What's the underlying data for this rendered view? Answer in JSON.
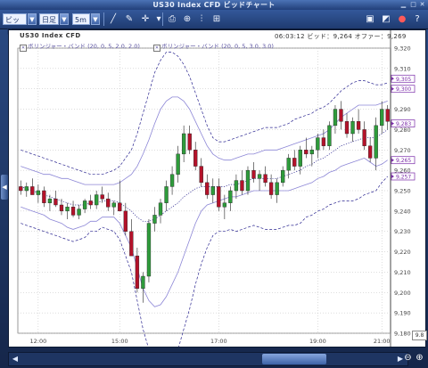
{
  "window": {
    "title": "US30 Index CFD ビッドチャート"
  },
  "toolbar": {
    "price_type": "ビッド",
    "chart_style": "日足",
    "timeframe": "5m"
  },
  "chart_header": {
    "symbol": "US30 Index CFD",
    "quote": "06:03:12 ビッド：9,264 オファー：9,269",
    "indicators": [
      "ボリンジャー・バンド (20, 0, 5, 2.0, 2.0)",
      "ボリンジャー・バンド (20, 0, 5, 3.0, 3.0)"
    ]
  },
  "markers": {
    "m1": "9,305",
    "m2": "9,300",
    "m3": "9,283",
    "m4": "9,265",
    "m5": "9,257"
  },
  "scale_tag": "9.8",
  "colors": {
    "up": "#2e9b3b",
    "down": "#b4122a",
    "band_inner": "#8c86d6",
    "band_outer": "#2a2590",
    "ma": "#2a2590",
    "marker": "#7a2aa8"
  },
  "chart_data": {
    "type": "candlestick",
    "x_ticks": [
      "12:00",
      "15:00",
      "17:00",
      "19:00",
      "21:00"
    ],
    "y_ticks": [
      "9,320",
      "9,310",
      "9,300",
      "9,290",
      "9,280",
      "9,270",
      "9,260",
      "9,250",
      "9,240",
      "9,230",
      "9,220",
      "9,210",
      "9,200",
      "9,190",
      "9,180"
    ],
    "ylim": [
      9180,
      9320
    ],
    "candles": [
      [
        9252,
        9255,
        9248,
        9250
      ],
      [
        9250,
        9254,
        9247,
        9252
      ],
      [
        9252,
        9256,
        9249,
        9248
      ],
      [
        9248,
        9253,
        9244,
        9250
      ],
      [
        9250,
        9252,
        9242,
        9244
      ],
      [
        9244,
        9248,
        9240,
        9246
      ],
      [
        9246,
        9250,
        9242,
        9243
      ],
      [
        9243,
        9246,
        9238,
        9240
      ],
      [
        9240,
        9244,
        9236,
        9242
      ],
      [
        9242,
        9245,
        9237,
        9238
      ],
      [
        9238,
        9243,
        9236,
        9241
      ],
      [
        9241,
        9246,
        9239,
        9245
      ],
      [
        9245,
        9248,
        9241,
        9243
      ],
      [
        9243,
        9250,
        9241,
        9248
      ],
      [
        9248,
        9252,
        9244,
        9246
      ],
      [
        9246,
        9249,
        9240,
        9242
      ],
      [
        9242,
        9245,
        9238,
        9244
      ],
      [
        9244,
        9255,
        9242,
        9240
      ],
      [
        9240,
        9244,
        9228,
        9230
      ],
      [
        9230,
        9236,
        9220,
        9218
      ],
      [
        9218,
        9222,
        9200,
        9202
      ],
      [
        9202,
        9210,
        9195,
        9208
      ],
      [
        9208,
        9236,
        9205,
        9234
      ],
      [
        9234,
        9242,
        9230,
        9238
      ],
      [
        9238,
        9246,
        9234,
        9244
      ],
      [
        9244,
        9255,
        9240,
        9252
      ],
      [
        9252,
        9262,
        9248,
        9258
      ],
      [
        9258,
        9272,
        9254,
        9268
      ],
      [
        9268,
        9282,
        9264,
        9278
      ],
      [
        9278,
        9282,
        9268,
        9270
      ],
      [
        9270,
        9274,
        9260,
        9262
      ],
      [
        9262,
        9266,
        9252,
        9254
      ],
      [
        9254,
        9258,
        9246,
        9248
      ],
      [
        9248,
        9256,
        9244,
        9252
      ],
      [
        9252,
        9256,
        9240,
        9242
      ],
      [
        9242,
        9248,
        9236,
        9244
      ],
      [
        9244,
        9252,
        9240,
        9250
      ],
      [
        9250,
        9258,
        9246,
        9255
      ],
      [
        9255,
        9260,
        9248,
        9250
      ],
      [
        9250,
        9262,
        9248,
        9260
      ],
      [
        9260,
        9264,
        9254,
        9256
      ],
      [
        9256,
        9260,
        9250,
        9258
      ],
      [
        9258,
        9262,
        9252,
        9254
      ],
      [
        9254,
        9258,
        9246,
        9248
      ],
      [
        9248,
        9256,
        9244,
        9254
      ],
      [
        9254,
        9262,
        9252,
        9260
      ],
      [
        9260,
        9268,
        9256,
        9266
      ],
      [
        9266,
        9270,
        9260,
        9262
      ],
      [
        9262,
        9272,
        9258,
        9270
      ],
      [
        9270,
        9276,
        9266,
        9268
      ],
      [
        9268,
        9272,
        9262,
        9270
      ],
      [
        9270,
        9278,
        9266,
        9276
      ],
      [
        9276,
        9280,
        9270,
        9272
      ],
      [
        9272,
        9284,
        9270,
        9282
      ],
      [
        9282,
        9292,
        9278,
        9290
      ],
      [
        9290,
        9294,
        9280,
        9284
      ],
      [
        9284,
        9288,
        9276,
        9278
      ],
      [
        9278,
        9286,
        9274,
        9284
      ],
      [
        9284,
        9290,
        9278,
        9280
      ],
      [
        9280,
        9284,
        9270,
        9272
      ],
      [
        9272,
        9276,
        9264,
        9266
      ],
      [
        9266,
        9286,
        9260,
        9282
      ],
      [
        9282,
        9294,
        9278,
        9290
      ],
      [
        9290,
        9292,
        9280,
        9284
      ]
    ],
    "series": [
      {
        "name": "ma",
        "values": [
          9252,
          9251,
          9250,
          9249,
          9248,
          9247,
          9246,
          9245,
          9244,
          9243,
          9243,
          9243,
          9244,
          9244,
          9245,
          9245,
          9245,
          9244,
          9242,
          9240,
          9237,
          9235,
          9235,
          9236,
          9238,
          9240,
          9242,
          9244,
          9247,
          9249,
          9251,
          9252,
          9252,
          9252,
          9252,
          9252,
          9253,
          9253,
          9254,
          9255,
          9256,
          9256,
          9256,
          9256,
          9256,
          9257,
          9258,
          9259,
          9260,
          9262,
          9263,
          9265,
          9266,
          9268,
          9270,
          9272,
          9273,
          9274,
          9275,
          9276,
          9276,
          9276,
          9278,
          9280
        ]
      },
      {
        "name": "inner_upper",
        "values": [
          9262,
          9261,
          9260,
          9259,
          9258,
          9258,
          9257,
          9256,
          9256,
          9255,
          9254,
          9253,
          9253,
          9253,
          9253,
          9253,
          9253,
          9254,
          9256,
          9258,
          9262,
          9268,
          9275,
          9283,
          9290,
          9294,
          9296,
          9296,
          9294,
          9290,
          9284,
          9278,
          9272,
          9268,
          9266,
          9265,
          9265,
          9266,
          9267,
          9268,
          9268,
          9269,
          9270,
          9270,
          9270,
          9271,
          9272,
          9273,
          9274,
          9275,
          9276,
          9277,
          9278,
          9280,
          9283,
          9286,
          9288,
          9290,
          9292,
          9292,
          9292,
          9292,
          9293,
          9294
        ]
      },
      {
        "name": "inner_lower",
        "values": [
          9242,
          9241,
          9240,
          9239,
          9238,
          9236,
          9235,
          9234,
          9232,
          9231,
          9232,
          9233,
          9235,
          9235,
          9237,
          9237,
          9237,
          9234,
          9228,
          9222,
          9212,
          9202,
          9196,
          9193,
          9194,
          9198,
          9204,
          9210,
          9218,
          9226,
          9234,
          9240,
          9243,
          9244,
          9245,
          9246,
          9247,
          9247,
          9248,
          9249,
          9250,
          9250,
          9250,
          9250,
          9250,
          9250,
          9250,
          9251,
          9252,
          9253,
          9254,
          9256,
          9257,
          9259,
          9260,
          9262,
          9263,
          9264,
          9265,
          9266,
          9264,
          9262,
          9263,
          9265
        ]
      },
      {
        "name": "outer_upper",
        "values": [
          9270,
          9269,
          9268,
          9267,
          9266,
          9265,
          9264,
          9263,
          9262,
          9261,
          9260,
          9259,
          9258,
          9258,
          9258,
          9259,
          9260,
          9262,
          9266,
          9270,
          9278,
          9288,
          9298,
          9308,
          9314,
          9318,
          9318,
          9316,
          9312,
          9306,
          9298,
          9290,
          9282,
          9276,
          9274,
          9274,
          9275,
          9276,
          9277,
          9278,
          9279,
          9280,
          9281,
          9281,
          9281,
          9282,
          9283,
          9285,
          9286,
          9287,
          9288,
          9290,
          9291,
          9293,
          9296,
          9299,
          9301,
          9303,
          9304,
          9304,
          9303,
          9302,
          9302,
          9303
        ]
      },
      {
        "name": "outer_lower",
        "values": [
          9234,
          9233,
          9232,
          9231,
          9230,
          9229,
          9228,
          9227,
          9226,
          9225,
          9226,
          9227,
          9230,
          9230,
          9232,
          9231,
          9230,
          9226,
          9218,
          9210,
          9196,
          9182,
          9172,
          9164,
          9162,
          9162,
          9166,
          9172,
          9182,
          9192,
          9204,
          9214,
          9222,
          9228,
          9230,
          9230,
          9231,
          9230,
          9231,
          9232,
          9233,
          9232,
          9231,
          9231,
          9231,
          9232,
          9233,
          9233,
          9234,
          9237,
          9238,
          9240,
          9241,
          9243,
          9244,
          9245,
          9245,
          9245,
          9246,
          9248,
          9249,
          9250,
          9254,
          9257
        ]
      }
    ],
    "title": "",
    "xlabel": "",
    "ylabel": "",
    "grid": true
  }
}
